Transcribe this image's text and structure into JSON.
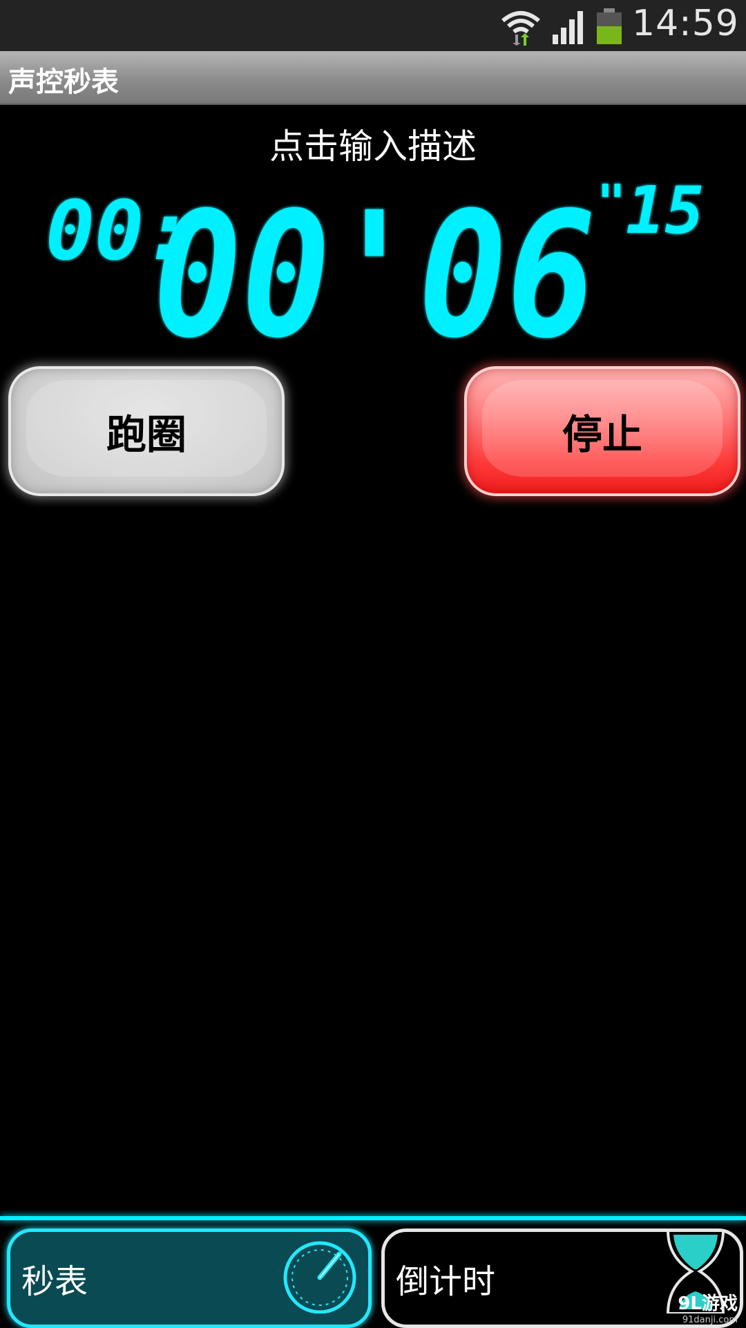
{
  "status_bar": {
    "time": "14:59",
    "icons": [
      "wifi-icon",
      "signal-icon",
      "battery-icon"
    ],
    "battery_color": "#7bb51c"
  },
  "title_bar": {
    "title": "声控秒表"
  },
  "main": {
    "description": "点击输入描述",
    "time": {
      "hours": "00:",
      "main": "00'06",
      "sub_mark": "\"",
      "hundredths": "15"
    },
    "display_color": "#00f0ff"
  },
  "buttons": {
    "lap_label": "跑圈",
    "stop_label": "停止"
  },
  "tabs": [
    {
      "label": "秒表",
      "icon": "stopwatch-icon",
      "active": true
    },
    {
      "label": "倒计时",
      "icon": "hourglass-icon",
      "active": false
    }
  ],
  "watermark": {
    "main": "9L游戏",
    "sub": "91danji.com"
  }
}
